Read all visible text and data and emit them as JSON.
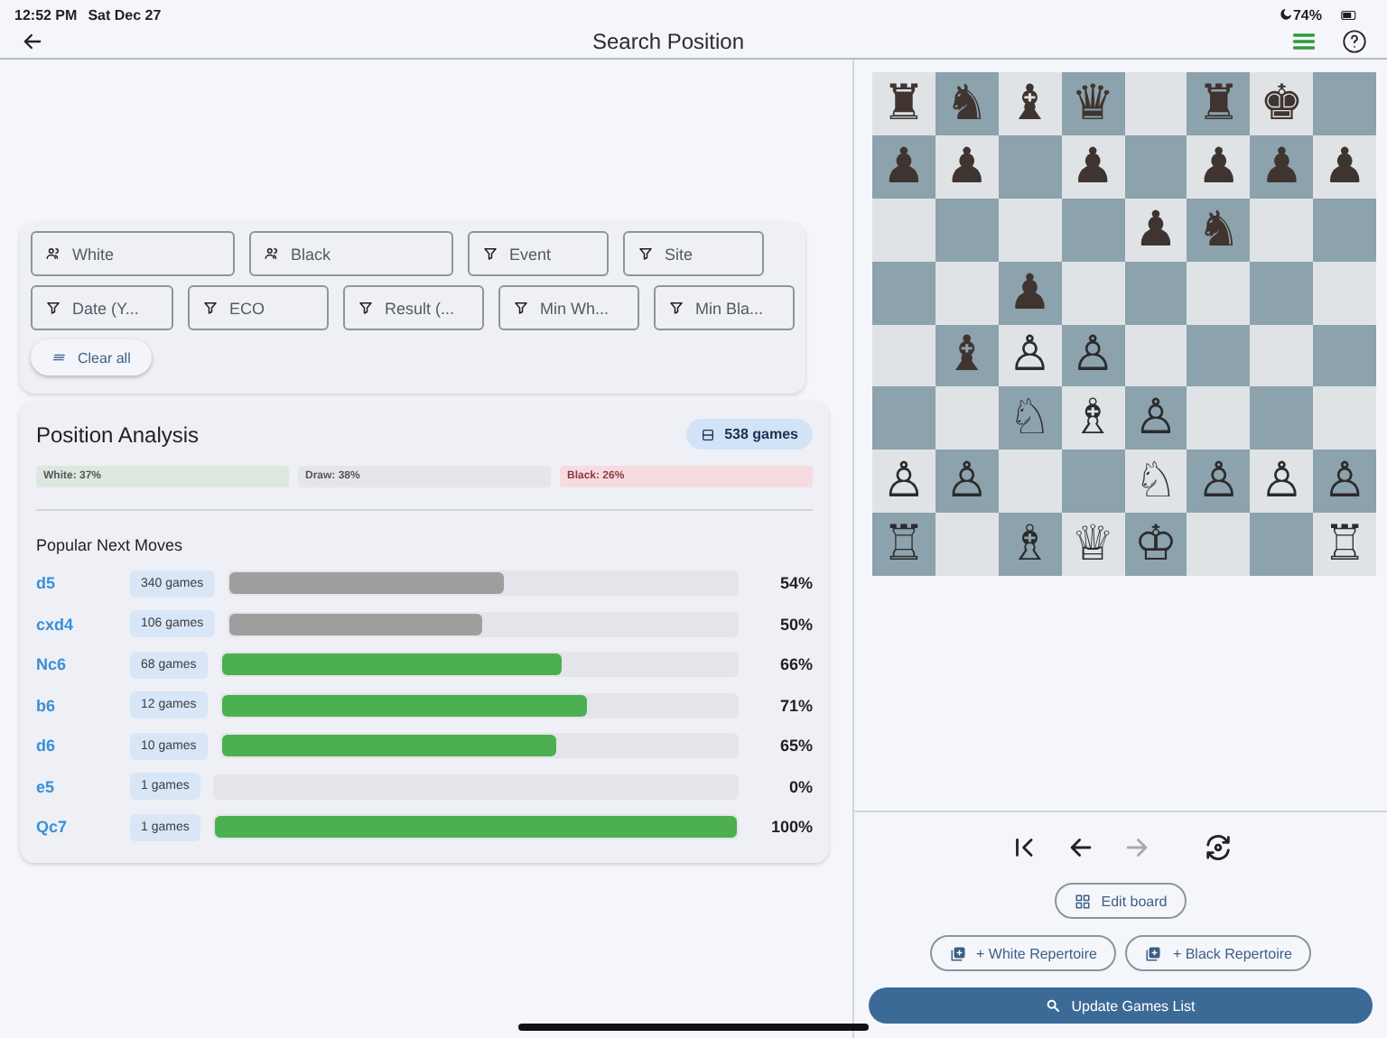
{
  "status_bar": {
    "time": "12:52 PM",
    "date": "Sat Dec 27",
    "battery": "74%"
  },
  "header": {
    "title": "Search Position"
  },
  "filters": [
    {
      "kind": "player",
      "placeholder": "White"
    },
    {
      "kind": "player",
      "placeholder": "Black"
    },
    {
      "kind": "filter",
      "placeholder": "Event"
    },
    {
      "kind": "filter",
      "placeholder": "Site"
    },
    {
      "kind": "filter",
      "placeholder": "Date (Y..."
    },
    {
      "kind": "filter",
      "placeholder": "ECO"
    },
    {
      "kind": "filter",
      "placeholder": "Result (..."
    },
    {
      "kind": "filter",
      "placeholder": "Min Wh..."
    },
    {
      "kind": "filter",
      "placeholder": "Min Bla..."
    }
  ],
  "clear_button": "Clear all",
  "analysis": {
    "title": "Position Analysis",
    "games_badge": "538 games",
    "results": [
      {
        "kind": "white",
        "label": "White: 37%"
      },
      {
        "kind": "draw",
        "label": "Draw: 38%"
      },
      {
        "kind": "black",
        "label": "Black: 26%"
      }
    ],
    "moves_title": "Popular Next Moves",
    "moves": [
      {
        "move": "d5",
        "games": "340 games",
        "level": 0.54,
        "color": "#9e9e9e",
        "percent": "54%"
      },
      {
        "move": "cxd4",
        "games": "106 games",
        "level": 0.5,
        "color": "#9e9e9e",
        "percent": "50%"
      },
      {
        "move": "Nc6",
        "games": "68 games",
        "level": 0.66,
        "color": "#4caf50",
        "percent": "66%"
      },
      {
        "move": "b6",
        "games": "12 games",
        "level": 0.71,
        "color": "#4caf50",
        "percent": "71%"
      },
      {
        "move": "d6",
        "games": "10 games",
        "level": 0.65,
        "color": "#4caf50",
        "percent": "65%"
      },
      {
        "move": "e5",
        "games": "1 games",
        "percent": "0%"
      },
      {
        "move": "Qc7",
        "games": "1 games",
        "level": 1,
        "color": "#4caf50",
        "percent": "100%"
      }
    ]
  },
  "board": {
    "ranks": [
      [
        {
          "kind": "black",
          "piece": "♜"
        },
        {
          "kind": "black",
          "piece": "♞"
        },
        {
          "kind": "black",
          "piece": "♝"
        },
        {
          "kind": "black",
          "piece": "♛"
        },
        {
          "kind": "empty"
        },
        {
          "kind": "black",
          "piece": "♜"
        },
        {
          "kind": "black",
          "piece": "♚"
        },
        {
          "kind": "empty"
        }
      ],
      [
        {
          "kind": "black",
          "piece": "♟"
        },
        {
          "kind": "black",
          "piece": "♟"
        },
        {
          "kind": "empty"
        },
        {
          "kind": "black",
          "piece": "♟"
        },
        {
          "kind": "empty"
        },
        {
          "kind": "black",
          "piece": "♟"
        },
        {
          "kind": "black",
          "piece": "♟"
        },
        {
          "kind": "black",
          "piece": "♟"
        }
      ],
      [
        {
          "kind": "empty"
        },
        {
          "kind": "empty"
        },
        {
          "kind": "empty"
        },
        {
          "kind": "empty"
        },
        {
          "kind": "black",
          "piece": "♟"
        },
        {
          "kind": "black",
          "piece": "♞"
        },
        {
          "kind": "empty"
        },
        {
          "kind": "empty"
        }
      ],
      [
        {
          "kind": "empty"
        },
        {
          "kind": "empty"
        },
        {
          "kind": "black",
          "piece": "♟"
        },
        {
          "kind": "empty"
        },
        {
          "kind": "empty"
        },
        {
          "kind": "empty"
        },
        {
          "kind": "empty"
        },
        {
          "kind": "empty"
        }
      ],
      [
        {
          "kind": "empty"
        },
        {
          "kind": "black",
          "piece": "♝"
        },
        {
          "kind": "white",
          "piece": "♙"
        },
        {
          "kind": "white",
          "piece": "♙"
        },
        {
          "kind": "empty"
        },
        {
          "kind": "empty"
        },
        {
          "kind": "empty"
        },
        {
          "kind": "empty"
        }
      ],
      [
        {
          "kind": "empty"
        },
        {
          "kind": "empty"
        },
        {
          "kind": "white",
          "piece": "♘"
        },
        {
          "kind": "white",
          "piece": "♗"
        },
        {
          "kind": "white",
          "piece": "♙"
        },
        {
          "kind": "empty"
        },
        {
          "kind": "empty"
        },
        {
          "kind": "empty"
        }
      ],
      [
        {
          "kind": "white",
          "piece": "♙"
        },
        {
          "kind": "white",
          "piece": "♙"
        },
        {
          "kind": "empty"
        },
        {
          "kind": "empty"
        },
        {
          "kind": "white",
          "piece": "♘"
        },
        {
          "kind": "white",
          "piece": "♙"
        },
        {
          "kind": "white",
          "piece": "♙"
        },
        {
          "kind": "white",
          "piece": "♙"
        }
      ],
      [
        {
          "kind": "white",
          "piece": "♖"
        },
        {
          "kind": "empty"
        },
        {
          "kind": "white",
          "piece": "♗"
        },
        {
          "kind": "white",
          "piece": "♕"
        },
        {
          "kind": "white",
          "piece": "♔"
        },
        {
          "kind": "empty"
        },
        {
          "kind": "empty"
        },
        {
          "kind": "white",
          "piece": "♖"
        }
      ]
    ]
  },
  "navigation": [
    {
      "kind": "first",
      "disabled": false
    },
    {
      "kind": "back",
      "disabled": false
    },
    {
      "kind": "forward",
      "disabled": true
    },
    {
      "kind": "flip",
      "disabled": false
    }
  ],
  "edit_button": "Edit board",
  "repertoire_buttons": [
    "+ White Repertoire",
    "+ Black Repertoire"
  ],
  "update_button": "Update Games List"
}
